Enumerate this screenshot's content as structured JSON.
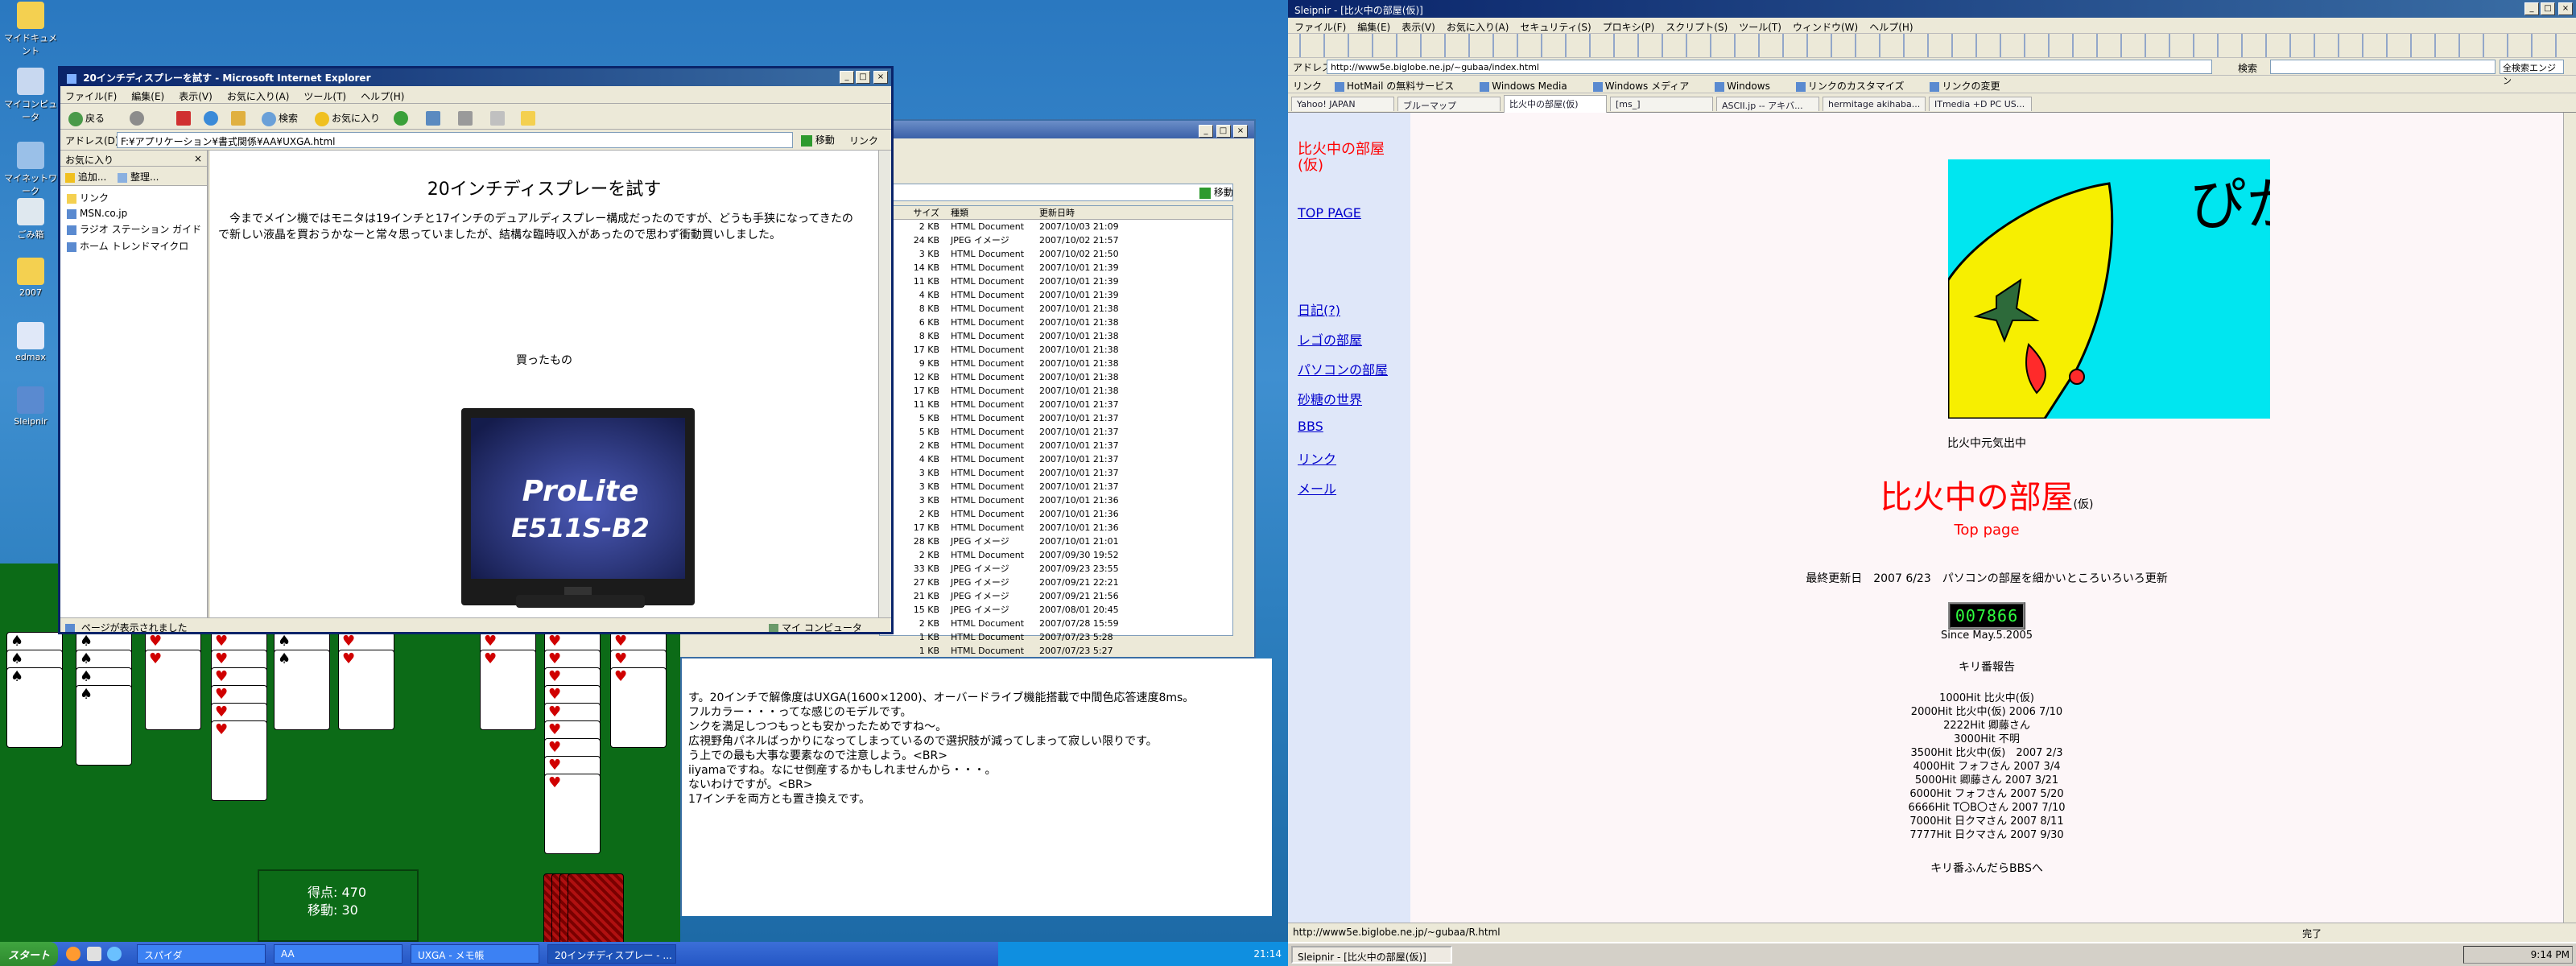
{
  "left_desktop": {
    "icons": [
      {
        "label": "マイドキュメント",
        "icon": "documents-icon"
      },
      {
        "label": "マイコンピュータ",
        "icon": "computer-icon"
      },
      {
        "label": "マイネットワーク",
        "icon": "network-icon"
      },
      {
        "label": "ごみ箱",
        "icon": "recycle-bin-icon"
      },
      {
        "label": "2007",
        "icon": "folder-icon"
      },
      {
        "label": "edmax",
        "icon": "mail-icon"
      },
      {
        "label": "Sleipnir",
        "icon": "sleipnir-icon"
      }
    ]
  },
  "ie_window": {
    "title": "20インチディスプレーを試す - Microsoft Internet Explorer",
    "menu": [
      "ファイル(F)",
      "編集(E)",
      "表示(V)",
      "お気に入り(A)",
      "ツール(T)",
      "ヘルプ(H)"
    ],
    "toolbar": {
      "back": "戻る",
      "search": "検索",
      "favorites": "お気に入り"
    },
    "address_label": "アドレス(D)",
    "address": "F:¥アプリケーション¥書式関係¥AA¥UXGA.html",
    "go_label": "移動",
    "links_label": "リンク",
    "favorites_pane": {
      "header": "お気に入り",
      "add": "追加...",
      "organize": "整理...",
      "items": [
        "リンク",
        "MSN.co.jp",
        "ラジオ ステーション ガイド",
        "ホーム トレンドマイクロ"
      ]
    },
    "status": "ページが表示されました",
    "zone": "マイ コンピュータ",
    "article": {
      "title": "20インチディスプレーを試す",
      "body": "今までメイン機ではモニタは19インチと17インチのデュアルディスプレー構成だったのですが、どうも手狭になってきたので新しい液晶を買おうかなーと常々思っていましたが、結構な臨時収入があったので思わず衝動買いしました。",
      "bought_label": "買ったもの",
      "monitor_brand": "ProLite",
      "monitor_model": "E511S-B2"
    }
  },
  "folder_window": {
    "go_label": "移動",
    "columns": [
      "サイズ",
      "種類",
      "更新日時"
    ],
    "rows": [
      [
        "2 KB",
        "HTML Document",
        "2007/10/03 21:09"
      ],
      [
        "24 KB",
        "JPEG イメージ",
        "2007/10/02 21:57"
      ],
      [
        "3 KB",
        "HTML Document",
        "2007/10/02 21:50"
      ],
      [
        "14 KB",
        "HTML Document",
        "2007/10/01 21:39"
      ],
      [
        "11 KB",
        "HTML Document",
        "2007/10/01 21:39"
      ],
      [
        "4 KB",
        "HTML Document",
        "2007/10/01 21:39"
      ],
      [
        "8 KB",
        "HTML Document",
        "2007/10/01 21:38"
      ],
      [
        "6 KB",
        "HTML Document",
        "2007/10/01 21:38"
      ],
      [
        "8 KB",
        "HTML Document",
        "2007/10/01 21:38"
      ],
      [
        "17 KB",
        "HTML Document",
        "2007/10/01 21:38"
      ],
      [
        "9 KB",
        "HTML Document",
        "2007/10/01 21:38"
      ],
      [
        "12 KB",
        "HTML Document",
        "2007/10/01 21:38"
      ],
      [
        "17 KB",
        "HTML Document",
        "2007/10/01 21:38"
      ],
      [
        "11 KB",
        "HTML Document",
        "2007/10/01 21:37"
      ],
      [
        "5 KB",
        "HTML Document",
        "2007/10/01 21:37"
      ],
      [
        "5 KB",
        "HTML Document",
        "2007/10/01 21:37"
      ],
      [
        "2 KB",
        "HTML Document",
        "2007/10/01 21:37"
      ],
      [
        "4 KB",
        "HTML Document",
        "2007/10/01 21:37"
      ],
      [
        "3 KB",
        "HTML Document",
        "2007/10/01 21:37"
      ],
      [
        "3 KB",
        "HTML Document",
        "2007/10/01 21:37"
      ],
      [
        "3 KB",
        "HTML Document",
        "2007/10/01 21:36"
      ],
      [
        "2 KB",
        "HTML Document",
        "2007/10/01 21:36"
      ],
      [
        "17 KB",
        "HTML Document",
        "2007/10/01 21:36"
      ],
      [
        "28 KB",
        "JPEG イメージ",
        "2007/10/01 21:01"
      ],
      [
        "2 KB",
        "HTML Document",
        "2007/09/30 19:52"
      ],
      [
        "33 KB",
        "JPEG イメージ",
        "2007/09/23 23:55"
      ],
      [
        "27 KB",
        "JPEG イメージ",
        "2007/09/21 22:21"
      ],
      [
        "21 KB",
        "JPEG イメージ",
        "2007/09/21 21:56"
      ],
      [
        "15 KB",
        "JPEG イメージ",
        "2007/08/01 20:45"
      ],
      [
        "2 KB",
        "HTML Document",
        "2007/07/28 15:59"
      ],
      [
        "1 KB",
        "HTML Document",
        "2007/07/23 5:28"
      ],
      [
        "1 KB",
        "HTML Document",
        "2007/07/23 5:27"
      ]
    ]
  },
  "notepad": {
    "lines": [
      "す。20インチで解像度はUXGA(1600×1200)、オーバードライブ機能搭載で中間色応答速度8ms。",
      "フルカラー・・・ってな感じのモデルです。",
      "ンクを満足しつつもっとも安かったためですね～。",
      "広視野角パネルばっかりになってしまっているので選択肢が減ってしまって寂しい限りです。",
      "う上での最も大事な要素なので注意しよう。<BR>",
      "iiyamaですね。なにせ倒産するかもしれませんから・・・。",
      "ないわけですが。<BR>",
      "17インチを両方とも置き換えです。"
    ]
  },
  "solitaire": {
    "title": "スパイダ",
    "score_label": "得点: 470",
    "moves_label": "移動: 30"
  },
  "left_taskbar": {
    "start": "スタート",
    "buttons": [
      "スパイダ",
      "AA",
      "UXGA - メモ帳",
      "20インチディスプレー - ..."
    ],
    "clock": "21:14"
  },
  "sleipnir": {
    "title": "Sleipnir - [比火中の部屋(仮)]",
    "menu": [
      "ファイル(F)",
      "編集(E)",
      "表示(V)",
      "お気に入り(A)",
      "セキュリティ(S)",
      "プロキシ(P)",
      "スクリプト(S)",
      "ツール(T)",
      "ウィンドウ(W)",
      "ヘルプ(H)"
    ],
    "address_label": "アドレス",
    "address": "http://www5e.biglobe.ne.jp/~gubaa/index.html",
    "search_label": "検索",
    "search_engine": "全検索エンジン",
    "links_label": "リンク",
    "links": [
      "HotMail の無料サービス",
      "Windows Media",
      "Windows メディア",
      "Windows",
      "リンクのカスタマイズ",
      "リンクの変更"
    ],
    "tabs": [
      "Yahoo! JAPAN",
      "ブルーマップ",
      "比火中の部屋(仮)",
      "[ms_]",
      "ASCII.jp -- アキバ...",
      "hermitage akihaba...",
      "ITmedia +D PC US..."
    ],
    "active_tab": 2,
    "status_url": "http://www5e.biglobe.ne.jp/~gubaa/R.html",
    "status_done": "完了",
    "nav": {
      "site_title": "比火中の部屋(仮)",
      "top_page": "TOP PAGE",
      "links": [
        "日記(?)",
        "レゴの部屋",
        "パソコンの部屋",
        "砂糖の世界",
        "BBS",
        "リンク",
        "メール"
      ]
    },
    "page": {
      "image_text": "ぴかあー",
      "caption": "比火中元気出中",
      "title": "比火中の部屋",
      "title_suffix": "(仮)",
      "subtitle": "Top page",
      "updated": "最終更新日　2007 6/23　パソコンの部屋を細かいところいろいろ更新",
      "counter": "007866",
      "since": "Since May.5.2005",
      "kiri_heading": "キリ番報告",
      "kiri": [
        "1000Hit 比火中(仮)",
        "2000Hit 比火中(仮) 2006 7/10",
        "2222Hit 卿藤さん",
        "3000Hit 不明",
        "3500Hit 比火中(仮)　2007 2/3",
        "4000Hit フォフさん 2007 3/4",
        "5000Hit 卿藤さん 2007 3/21",
        "6000Hit フォフさん 2007 5/20",
        "6666Hit T〇B〇さん 2007 7/10",
        "7000Hit 日クマさん 2007 8/11",
        "7777Hit 日クマさん 2007 9/30"
      ],
      "kiri_footer": "キリ番ふんだらBBSへ"
    }
  },
  "right_taskbar": {
    "button": "Sleipnir - [比火中の部屋(仮)]",
    "clock": "9:14 PM"
  },
  "colors": {
    "desktop_blue": "#2a78c0",
    "solitaire_green": "#0c6b17",
    "title_blue": "#0a246a",
    "page_red": "#ff0000",
    "link_blue": "#0000cc",
    "pika_cyan": "#00e6f0",
    "pika_yellow": "#f7ef00"
  }
}
